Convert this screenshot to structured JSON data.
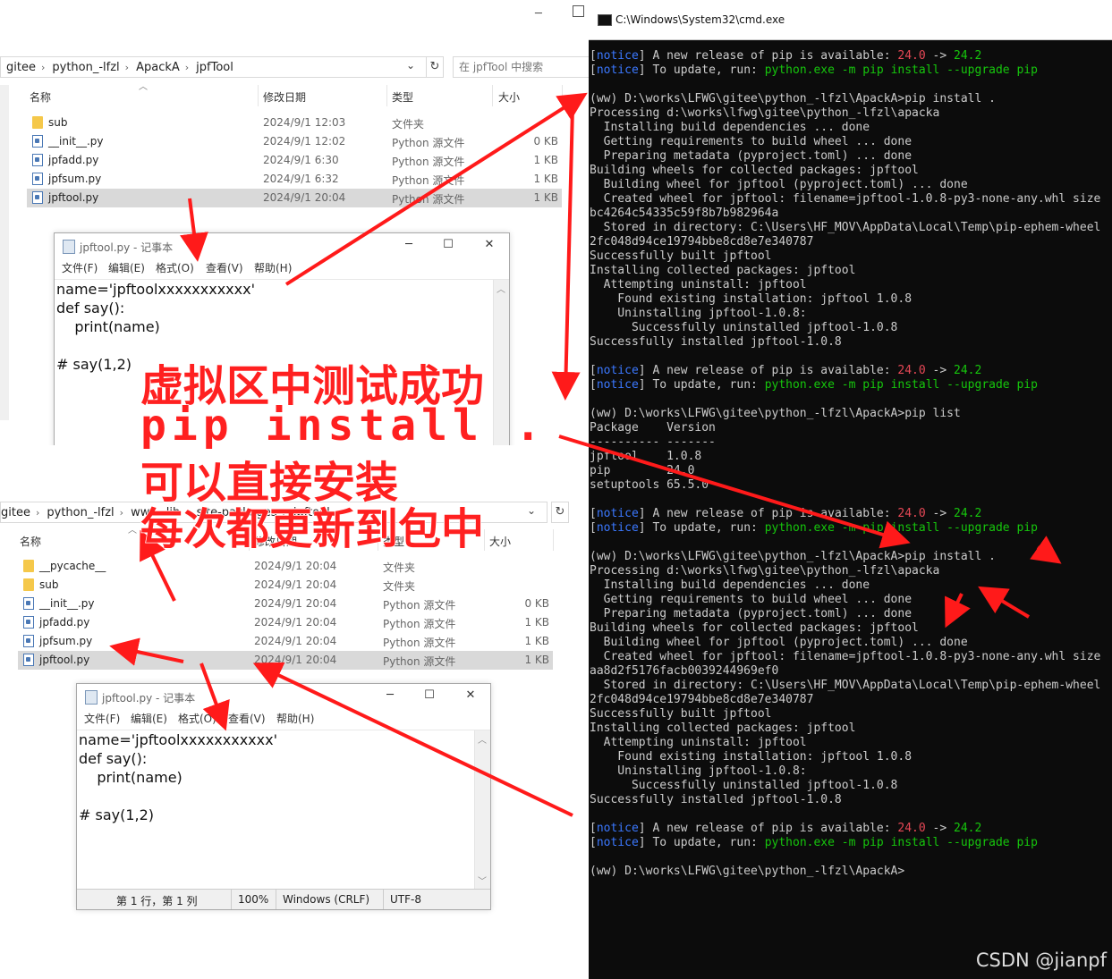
{
  "explorer_top": {
    "address": [
      "gitee",
      "python_-lfzl",
      "ApackA",
      "jpfTool"
    ],
    "search_placeholder": "在 jpfTool 中搜索",
    "columns": {
      "name": "名称",
      "date": "修改日期",
      "type": "类型",
      "size": "大小"
    },
    "files": [
      {
        "name": "sub",
        "date": "2024/9/1 12:03",
        "type": "文件夹",
        "size": "",
        "icon": "folder-icon"
      },
      {
        "name": "__init__.py",
        "date": "2024/9/1 12:02",
        "type": "Python 源文件",
        "size": "0 KB",
        "icon": "python-file-icon"
      },
      {
        "name": "jpfadd.py",
        "date": "2024/9/1 6:30",
        "type": "Python 源文件",
        "size": "1 KB",
        "icon": "python-file-icon"
      },
      {
        "name": "jpfsum.py",
        "date": "2024/9/1 6:32",
        "type": "Python 源文件",
        "size": "1 KB",
        "icon": "python-file-icon"
      },
      {
        "name": "jpftool.py",
        "date": "2024/9/1 20:04",
        "type": "Python 源文件",
        "size": "1 KB",
        "icon": "python-file-icon",
        "selected": true
      }
    ]
  },
  "explorer_bottom": {
    "address": [
      "gitee",
      "python_-lfzl",
      "ww",
      "lib",
      "site-packages",
      "jpftool"
    ],
    "columns": {
      "name": "名称",
      "date": "修改日期",
      "type": "类型",
      "size": "大小"
    },
    "files": [
      {
        "name": "__pycache__",
        "date": "2024/9/1 20:04",
        "type": "文件夹",
        "size": "",
        "icon": "folder-icon"
      },
      {
        "name": "sub",
        "date": "2024/9/1 20:04",
        "type": "文件夹",
        "size": "",
        "icon": "folder-icon"
      },
      {
        "name": "__init__.py",
        "date": "2024/9/1 20:04",
        "type": "Python 源文件",
        "size": "0 KB",
        "icon": "python-file-icon"
      },
      {
        "name": "jpfadd.py",
        "date": "2024/9/1 20:04",
        "type": "Python 源文件",
        "size": "1 KB",
        "icon": "python-file-icon"
      },
      {
        "name": "jpfsum.py",
        "date": "2024/9/1 20:04",
        "type": "Python 源文件",
        "size": "1 KB",
        "icon": "python-file-icon"
      },
      {
        "name": "jpftool.py",
        "date": "2024/9/1 20:04",
        "type": "Python 源文件",
        "size": "1 KB",
        "icon": "python-file-icon",
        "selected": true
      }
    ]
  },
  "notepad_top": {
    "title": "jpftool.py - 记事本",
    "menu": [
      "文件(F)",
      "编辑(E)",
      "格式(O)",
      "查看(V)",
      "帮助(H)"
    ],
    "content": "name='jpftoolxxxxxxxxxxx'\ndef say():\n    print(name)\n\n# say(1,2)"
  },
  "notepad_bottom": {
    "title": "jpftool.py - 记事本",
    "menu": [
      "文件(F)",
      "编辑(E)",
      "格式(O)",
      "查看(V)",
      "帮助(H)"
    ],
    "content": "name='jpftoolxxxxxxxxxxx'\ndef say():\n    print(name)\n\n# say(1,2)",
    "status": {
      "position": "第 1 行，第 1 列",
      "zoom": "100%",
      "eol": "Windows (CRLF)",
      "encoding": "UTF-8"
    }
  },
  "terminal": {
    "title": "C:\\Windows\\System32\\cmd.exe",
    "lines": [
      [
        {
          "t": "[",
          "c": "w"
        },
        {
          "t": "notice",
          "c": "b"
        },
        {
          "t": "] A new release of pip is available: ",
          "c": "w"
        },
        {
          "t": "24.0",
          "c": "r"
        },
        {
          "t": " -> ",
          "c": "w"
        },
        {
          "t": "24.2",
          "c": "g"
        }
      ],
      [
        {
          "t": "[",
          "c": "w"
        },
        {
          "t": "notice",
          "c": "b"
        },
        {
          "t": "] To update, run: ",
          "c": "w"
        },
        {
          "t": "python.exe -m pip install --upgrade pip",
          "c": "g"
        }
      ],
      [],
      [
        {
          "t": "(ww) D:\\works\\LFWG\\gitee\\python_-lfzl\\ApackA>pip install .",
          "c": "w"
        }
      ],
      [
        {
          "t": "Processing d:\\works\\lfwg\\gitee\\python_-lfzl\\apacka",
          "c": "w"
        }
      ],
      [
        {
          "t": "  Installing build dependencies ... done",
          "c": "w"
        }
      ],
      [
        {
          "t": "  Getting requirements to build wheel ... done",
          "c": "w"
        }
      ],
      [
        {
          "t": "  Preparing metadata (pyproject.toml) ... done",
          "c": "w"
        }
      ],
      [
        {
          "t": "Building wheels for collected packages: jpftool",
          "c": "w"
        }
      ],
      [
        {
          "t": "  Building wheel for jpftool (pyproject.toml) ... done",
          "c": "w"
        }
      ],
      [
        {
          "t": "  Created wheel for jpftool: filename=jpftool-1.0.8-py3-none-any.whl size",
          "c": "w"
        }
      ],
      [
        {
          "t": "bc4264c54335c59f8b7b982964a",
          "c": "w"
        }
      ],
      [
        {
          "t": "  Stored in directory: C:\\Users\\HF_MOV\\AppData\\Local\\Temp\\pip-ephem-wheel",
          "c": "w"
        }
      ],
      [
        {
          "t": "2fc048d94ce19794bbe8cd8e7e340787",
          "c": "w"
        }
      ],
      [
        {
          "t": "Successfully built jpftool",
          "c": "w"
        }
      ],
      [
        {
          "t": "Installing collected packages: jpftool",
          "c": "w"
        }
      ],
      [
        {
          "t": "  Attempting uninstall: jpftool",
          "c": "w"
        }
      ],
      [
        {
          "t": "    Found existing installation: jpftool 1.0.8",
          "c": "w"
        }
      ],
      [
        {
          "t": "    Uninstalling jpftool-1.0.8:",
          "c": "w"
        }
      ],
      [
        {
          "t": "      Successfully uninstalled jpftool-1.0.8",
          "c": "w"
        }
      ],
      [
        {
          "t": "Successfully installed jpftool-1.0.8",
          "c": "w"
        }
      ],
      [],
      [
        {
          "t": "[",
          "c": "w"
        },
        {
          "t": "notice",
          "c": "b"
        },
        {
          "t": "] A new release of pip is available: ",
          "c": "w"
        },
        {
          "t": "24.0",
          "c": "r"
        },
        {
          "t": " -> ",
          "c": "w"
        },
        {
          "t": "24.2",
          "c": "g"
        }
      ],
      [
        {
          "t": "[",
          "c": "w"
        },
        {
          "t": "notice",
          "c": "b"
        },
        {
          "t": "] To update, run: ",
          "c": "w"
        },
        {
          "t": "python.exe -m pip install --upgrade pip",
          "c": "g"
        }
      ],
      [],
      [
        {
          "t": "(ww) D:\\works\\LFWG\\gitee\\python_-lfzl\\ApackA>pip list",
          "c": "w"
        }
      ],
      [
        {
          "t": "Package    Version",
          "c": "w"
        }
      ],
      [
        {
          "t": "---------- -------",
          "c": "w"
        }
      ],
      [
        {
          "t": "jpftool    1.0.8",
          "c": "w"
        }
      ],
      [
        {
          "t": "pip        24.0",
          "c": "w"
        }
      ],
      [
        {
          "t": "setuptools 65.5.0",
          "c": "w"
        }
      ],
      [],
      [
        {
          "t": "[",
          "c": "w"
        },
        {
          "t": "notice",
          "c": "b"
        },
        {
          "t": "] A new release of pip is available: ",
          "c": "w"
        },
        {
          "t": "24.0",
          "c": "r"
        },
        {
          "t": " -> ",
          "c": "w"
        },
        {
          "t": "24.2",
          "c": "g"
        }
      ],
      [
        {
          "t": "[",
          "c": "w"
        },
        {
          "t": "notice",
          "c": "b"
        },
        {
          "t": "] To update, run: ",
          "c": "w"
        },
        {
          "t": "python.exe -m pip install --upgrade pip",
          "c": "g"
        }
      ],
      [],
      [
        {
          "t": "(ww) D:\\works\\LFWG\\gitee\\python_-lfzl\\ApackA>pip install .",
          "c": "w"
        }
      ],
      [
        {
          "t": "Processing d:\\works\\lfwg\\gitee\\python_-lfzl\\apacka",
          "c": "w"
        }
      ],
      [
        {
          "t": "  Installing build dependencies ... done",
          "c": "w"
        }
      ],
      [
        {
          "t": "  Getting requirements to build wheel ... done",
          "c": "w"
        }
      ],
      [
        {
          "t": "  Preparing metadata (pyproject.toml) ... done",
          "c": "w"
        }
      ],
      [
        {
          "t": "Building wheels for collected packages: jpftool",
          "c": "w"
        }
      ],
      [
        {
          "t": "  Building wheel for jpftool (pyproject.toml) ... done",
          "c": "w"
        }
      ],
      [
        {
          "t": "  Created wheel for jpftool: filename=jpftool-1.0.8-py3-none-any.whl size",
          "c": "w"
        }
      ],
      [
        {
          "t": "aa8d2f5176facb0039244969ef0",
          "c": "w"
        }
      ],
      [
        {
          "t": "  Stored in directory: C:\\Users\\HF_MOV\\AppData\\Local\\Temp\\pip-ephem-wheel",
          "c": "w"
        }
      ],
      [
        {
          "t": "2fc048d94ce19794bbe8cd8e7e340787",
          "c": "w"
        }
      ],
      [
        {
          "t": "Successfully built jpftool",
          "c": "w"
        }
      ],
      [
        {
          "t": "Installing collected packages: jpftool",
          "c": "w"
        }
      ],
      [
        {
          "t": "  Attempting uninstall: jpftool",
          "c": "w"
        }
      ],
      [
        {
          "t": "    Found existing installation: jpftool 1.0.8",
          "c": "w"
        }
      ],
      [
        {
          "t": "    Uninstalling jpftool-1.0.8:",
          "c": "w"
        }
      ],
      [
        {
          "t": "      Successfully uninstalled jpftool-1.0.8",
          "c": "w"
        }
      ],
      [
        {
          "t": "Successfully installed jpftool-1.0.8",
          "c": "w"
        }
      ],
      [],
      [
        {
          "t": "[",
          "c": "w"
        },
        {
          "t": "notice",
          "c": "b"
        },
        {
          "t": "] A new release of pip is available: ",
          "c": "w"
        },
        {
          "t": "24.0",
          "c": "r"
        },
        {
          "t": " -> ",
          "c": "w"
        },
        {
          "t": "24.2",
          "c": "g"
        }
      ],
      [
        {
          "t": "[",
          "c": "w"
        },
        {
          "t": "notice",
          "c": "b"
        },
        {
          "t": "] To update, run: ",
          "c": "w"
        },
        {
          "t": "python.exe -m pip install --upgrade pip",
          "c": "g"
        }
      ],
      [],
      [
        {
          "t": "(ww) D:\\works\\LFWG\\gitee\\python_-lfzl\\ApackA>",
          "c": "w"
        }
      ]
    ]
  },
  "annotation": {
    "line1": "虚拟区中测试成功",
    "line2": "pip install .",
    "line3": "可以直接安装",
    "line4": "每次都更新到包中",
    "color": "#ff2020"
  },
  "watermark": "CSDN @jianpf",
  "colors": {
    "terminal_bg": "#0c0c0c",
    "terminal_text": "#cccccc",
    "notice_blue": "#3b78ff",
    "version_red": "#e74856",
    "cmd_green": "#16c60c",
    "selection": "#d9d9d9"
  }
}
